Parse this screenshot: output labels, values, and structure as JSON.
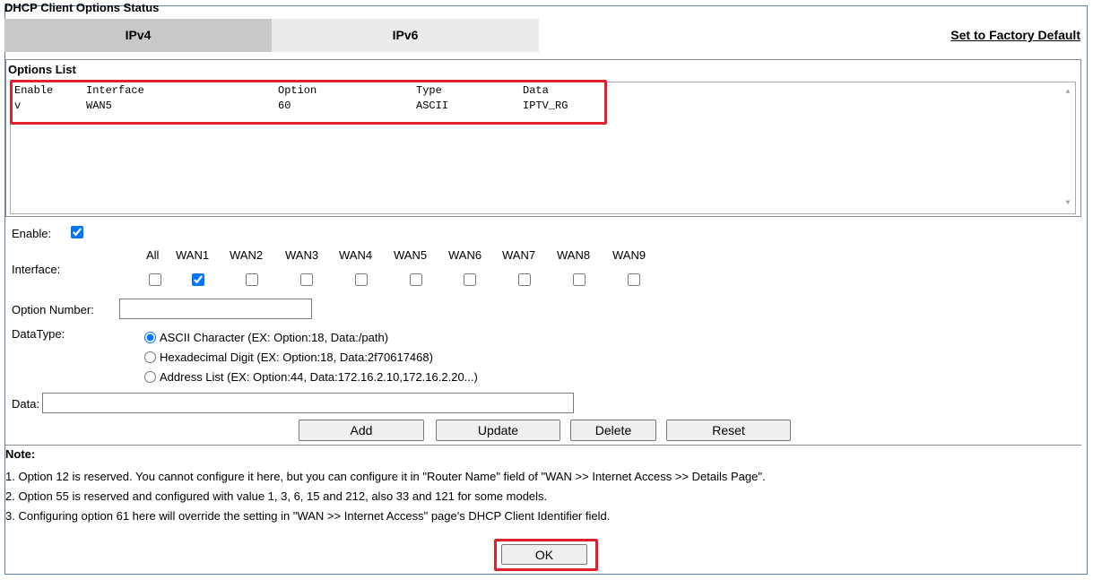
{
  "page_title": "DHCP Client Options Status",
  "tabs": [
    {
      "label": "IPv4",
      "active": true
    },
    {
      "label": "IPv6",
      "active": false
    }
  ],
  "factory_default_link": "Set to Factory Default",
  "options_list": {
    "title": "Options List",
    "headers": [
      "Enable",
      "Interface",
      "Option",
      "Type",
      "Data"
    ],
    "rows": [
      [
        "v",
        "WAN5",
        "60",
        "ASCII",
        "IPTV_RG"
      ]
    ]
  },
  "form": {
    "enable_label": "Enable:",
    "enable_checked": true,
    "interface_label": "Interface:",
    "interfaces": [
      {
        "label": "All",
        "checked": false
      },
      {
        "label": "WAN1",
        "checked": true
      },
      {
        "label": "WAN2",
        "checked": false
      },
      {
        "label": "WAN3",
        "checked": false
      },
      {
        "label": "WAN4",
        "checked": false
      },
      {
        "label": "WAN5",
        "checked": false
      },
      {
        "label": "WAN6",
        "checked": false
      },
      {
        "label": "WAN7",
        "checked": false
      },
      {
        "label": "WAN8",
        "checked": false
      },
      {
        "label": "WAN9",
        "checked": false
      }
    ],
    "option_number_label": "Option Number:",
    "option_number_value": "",
    "datatype_label": "DataType:",
    "datatypes": [
      {
        "label": "ASCII Character (EX: Option:18, Data:/path)",
        "selected": true
      },
      {
        "label": "Hexadecimal Digit (EX: Option:18, Data:2f70617468)",
        "selected": false
      },
      {
        "label": "Address List (EX: Option:44, Data:172.16.2.10,172.16.2.20...)",
        "selected": false
      }
    ],
    "data_label": "Data:",
    "data_value": ""
  },
  "buttons": {
    "add": "Add",
    "update": "Update",
    "delete": "Delete",
    "reset": "Reset",
    "ok": "OK"
  },
  "notes": {
    "title": "Note:",
    "lines": [
      "1. Option 12 is reserved. You cannot configure it here, but you can configure it in \"Router Name\" field of \"WAN >> Internet Access >> Details Page\".",
      "2. Option 55 is reserved and configured with value 1, 3, 6, 15 and 212, also 33 and 121 for some models.",
      "3. Configuring option 61 here will override the setting in \"WAN >> Internet Access\" page's DHCP Client Identifier field."
    ]
  },
  "colors": {
    "highlight": "#e0202a",
    "tab_active": "#c8c8c8",
    "tab_inactive": "#ebebeb",
    "frame_border": "#5a7fa3"
  }
}
